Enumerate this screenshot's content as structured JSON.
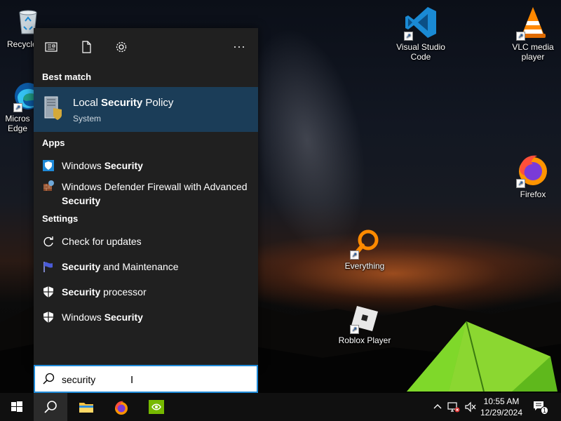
{
  "desktop_icons": {
    "recycle_bin": "Recycle",
    "edge": "Micros Edge",
    "vscode": "Visual Studio Code",
    "vlc": "VLC media player",
    "firefox": "Firefox",
    "everything": "Everything",
    "roblox": "Roblox Player"
  },
  "start_menu": {
    "best_match_header": "Best match",
    "best_match": {
      "title_pre": "Local ",
      "title_bold": "Security",
      "title_post": " Policy",
      "subtitle": "System"
    },
    "apps_header": "Apps",
    "apps": [
      {
        "pre": "Windows ",
        "bold": "Security",
        "post": ""
      },
      {
        "pre": "Windows Defender Firewall with Advanced ",
        "bold": "Security",
        "post": ""
      }
    ],
    "settings_header": "Settings",
    "settings": [
      {
        "pre": "Check for updates",
        "bold": "",
        "post": ""
      },
      {
        "pre": "",
        "bold": "Security",
        "post": " and Maintenance"
      },
      {
        "pre": "",
        "bold": "Security",
        "post": " processor"
      },
      {
        "pre": "Windows ",
        "bold": "Security",
        "post": ""
      }
    ]
  },
  "search": {
    "value": "security"
  },
  "taskbar": {
    "time": "10:55 AM",
    "date": "12/29/2024",
    "notification_count": "1"
  },
  "icons": {
    "top_bar": [
      "news-icon",
      "document-icon",
      "gear-icon",
      "more-icon"
    ],
    "taskbar": [
      "windows-start-icon",
      "search-icon",
      "file-explorer-icon",
      "firefox-icon",
      "nvidia-icon"
    ],
    "tray": [
      "chevron-up-icon",
      "network-icon",
      "volume-muted-icon",
      "notification-icon"
    ]
  }
}
